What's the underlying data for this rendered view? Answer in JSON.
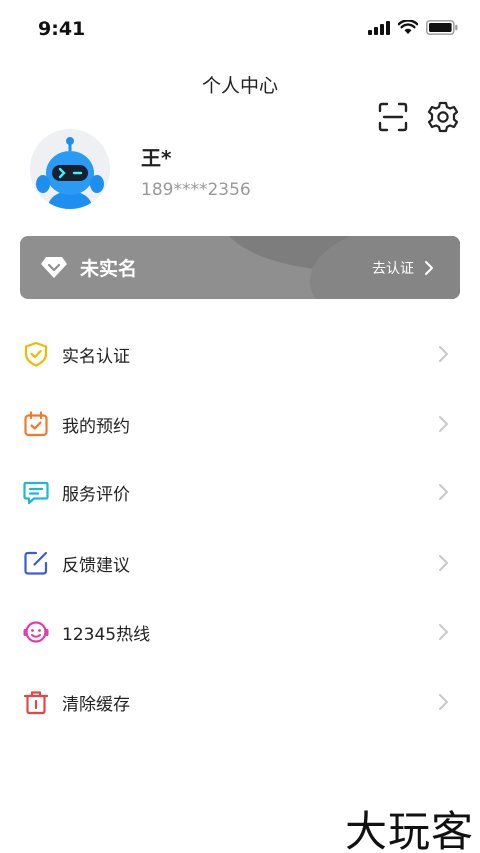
{
  "status_bar": {
    "time": "9:41"
  },
  "header": {
    "title": "个人中心"
  },
  "profile": {
    "name": "王*",
    "phone": "189****2356"
  },
  "verification": {
    "status": "未实名",
    "action": "去认证"
  },
  "menu": [
    {
      "label": "实名认证",
      "icon": "shield-check-icon",
      "color": "#f5b800"
    },
    {
      "label": "我的预约",
      "icon": "calendar-check-icon",
      "color": "#f07a2a"
    },
    {
      "label": "服务评价",
      "icon": "chat-icon",
      "color": "#1fb6d6"
    },
    {
      "label": "反馈建议",
      "icon": "edit-icon",
      "color": "#3d5bd6"
    },
    {
      "label": "12345热线",
      "icon": "headset-icon",
      "color": "#e83aa6"
    },
    {
      "label": "清除缓存",
      "icon": "trash-icon",
      "color": "#e64545"
    }
  ],
  "watermark": "大玩客"
}
